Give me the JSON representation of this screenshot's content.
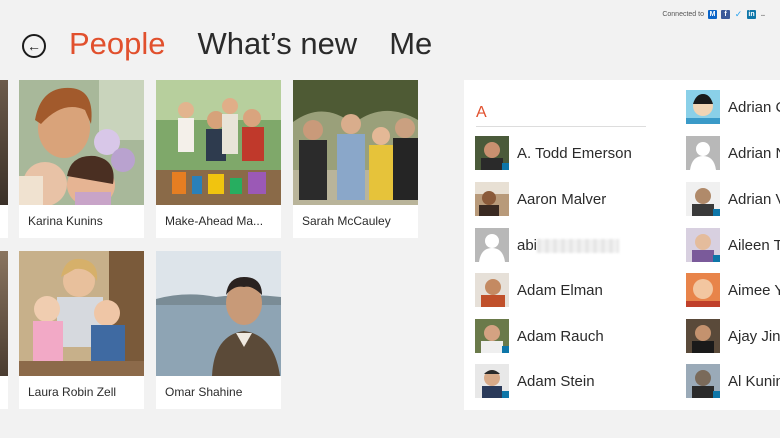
{
  "connected": {
    "label": "Connected to",
    "services": [
      "outlook-icon",
      "facebook-icon",
      "twitter-icon",
      "linkedin-icon",
      "more-icon"
    ]
  },
  "nav": {
    "back": "back-arrow-icon",
    "tabs": [
      "People",
      "What’s new",
      "Me"
    ],
    "active": 0
  },
  "tiles": [
    {
      "name": "Karina Kunins"
    },
    {
      "name": "Make-Ahead Ma..."
    },
    {
      "name": "Sarah McCauley"
    },
    {
      "name": "Laura Robin Zell"
    },
    {
      "name": "Omar Shahine"
    }
  ],
  "contacts": {
    "letter": "A",
    "column1": [
      {
        "name": "A. Todd Emerson"
      },
      {
        "name": "Aaron Malver"
      },
      {
        "name": "abi"
      },
      {
        "name": "Adam Elman"
      },
      {
        "name": "Adam Rauch"
      },
      {
        "name": "Adam Stein"
      }
    ],
    "column2": [
      {
        "name": "Adrian C"
      },
      {
        "name": "Adrian N"
      },
      {
        "name": "Adrian V"
      },
      {
        "name": "Aileen Ta"
      },
      {
        "name": "Aimee Y"
      },
      {
        "name": "Ajay Jinc"
      },
      {
        "name": "Al Kunin"
      }
    ]
  },
  "colors": {
    "accent": "#e1502d",
    "background": "#f2f2f2"
  }
}
